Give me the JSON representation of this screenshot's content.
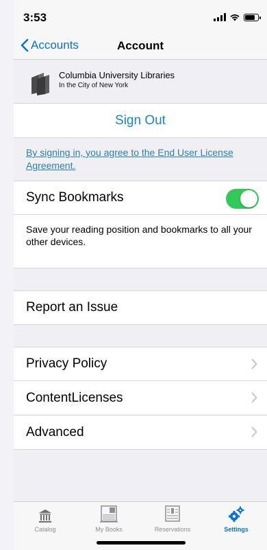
{
  "status": {
    "time": "3:53"
  },
  "nav": {
    "back_label": "Accounts",
    "title": "Account"
  },
  "account": {
    "name": "Columbia University Libraries",
    "location": "In the City of New York"
  },
  "signout": {
    "label": "Sign Out"
  },
  "eula": {
    "text": "By signing in, you agree to the End User License Agreement."
  },
  "sync": {
    "label": "Sync Bookmarks",
    "enabled": true,
    "description": "Save your reading position and bookmarks to all your other devices."
  },
  "report": {
    "label": "Report an Issue"
  },
  "links": [
    {
      "label": "Privacy Policy"
    },
    {
      "label": "ContentLicenses"
    },
    {
      "label": "Advanced"
    }
  ],
  "tabs": [
    {
      "label": "Catalog",
      "icon": "bank-icon"
    },
    {
      "label": "My Books",
      "icon": "books-icon"
    },
    {
      "label": "Reservations",
      "icon": "reservations-icon"
    },
    {
      "label": "Settings",
      "icon": "gears-icon",
      "active": true
    }
  ],
  "colors": {
    "accent": "#0a72c9",
    "toggle_on": "#34c759",
    "link": "#2a7fb3"
  }
}
